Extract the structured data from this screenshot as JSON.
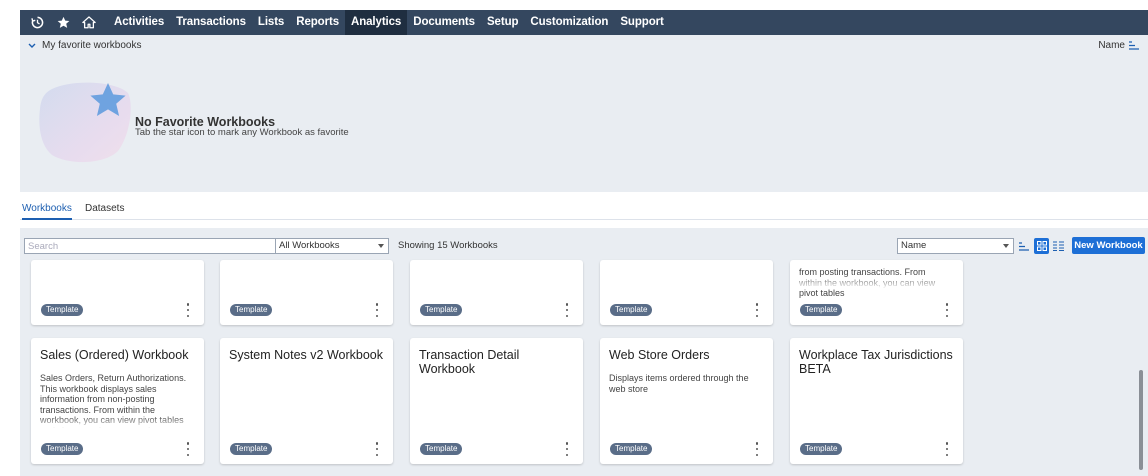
{
  "nav": {
    "icons": [
      "recent-icon",
      "star-icon",
      "home-icon"
    ],
    "items": [
      "Activities",
      "Transactions",
      "Lists",
      "Reports",
      "Analytics",
      "Documents",
      "Setup",
      "Customization",
      "Support"
    ],
    "active": "Analytics"
  },
  "favorites": {
    "header": "My favorite workbooks",
    "sort_label": "Name",
    "empty_title": "No Favorite Workbooks",
    "empty_subtitle": "Tab the star icon to mark any Workbook as favorite"
  },
  "tabs": [
    "Workbooks",
    "Datasets"
  ],
  "toolbar": {
    "search_placeholder": "Search",
    "filter_value": "All Workbooks",
    "showing": "Showing 15 Workbooks",
    "sort_value": "Name",
    "new_button": "New Workbook"
  },
  "cards_top_row": [
    {
      "title": "",
      "desc": "",
      "badge": "Template"
    },
    {
      "title": "",
      "desc": "",
      "badge": "Template"
    },
    {
      "title": "",
      "desc": "",
      "badge": "Template"
    },
    {
      "title": "",
      "desc": "",
      "badge": "Template"
    },
    {
      "title": "",
      "desc": "from posting transactions. From within the workbook, you can view pivot tables",
      "badge": "Template"
    }
  ],
  "cards_bottom_row": [
    {
      "title": "Sales (Ordered) Workbook",
      "desc": "Sales Orders, Return Authorizations. This workbook displays sales information from non-posting transactions. From within the workbook, you can view pivot tables and charts so that you can better",
      "badge": "Template"
    },
    {
      "title": "System Notes v2 Workbook",
      "desc": "",
      "badge": "Template"
    },
    {
      "title": "Transaction Detail Workbook",
      "desc": "",
      "badge": "Template"
    },
    {
      "title": "Web Store Orders",
      "desc": "Displays items ordered through the web store",
      "badge": "Template"
    },
    {
      "title": "Workplace Tax Jurisdictions BETA",
      "desc": "",
      "badge": "Template"
    }
  ],
  "colors": {
    "nav_bg": "#34475f",
    "nav_active": "#1f2e40",
    "panel_bg": "#e9edf2",
    "accent": "#1d5fb1",
    "button": "#1d6fd6",
    "badge": "#5a6d88"
  }
}
